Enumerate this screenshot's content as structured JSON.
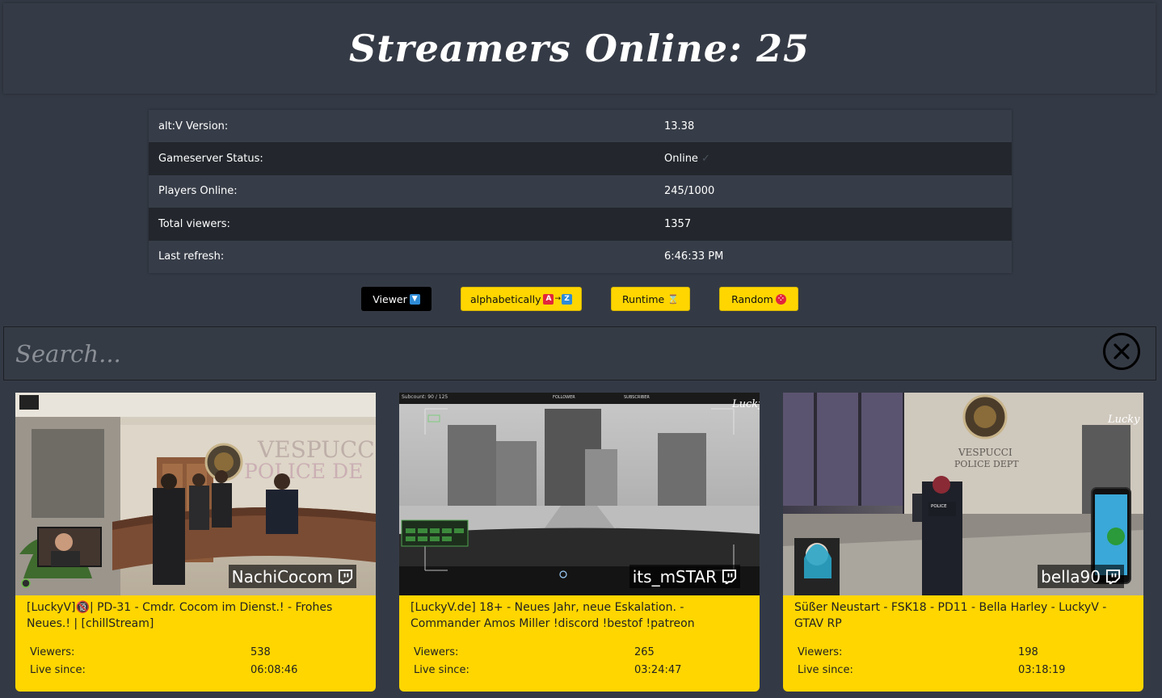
{
  "header": {
    "title": "Streamers Online: 25"
  },
  "info": [
    {
      "label": "alt:V Version:",
      "value": "13.38"
    },
    {
      "label": "Gameserver Status:",
      "value": "Online",
      "check": "✓"
    },
    {
      "label": "Players Online:",
      "value": "245/1000"
    },
    {
      "label": "Total viewers:",
      "value": "1357"
    },
    {
      "label": "Last refresh:",
      "value": "6:46:33 PM"
    }
  ],
  "sort": {
    "viewer": "Viewer",
    "alpha": "alphabetically",
    "runtime": "Runtime",
    "random": "Random",
    "alpha_from": "A",
    "alpha_to": "Z"
  },
  "search": {
    "placeholder": "Search..."
  },
  "labels": {
    "viewers": "Viewers:",
    "live_since": "Live since:"
  },
  "streams": [
    {
      "name": "NachiCocom",
      "title": "[LuckyV]🔞| PD-31 - Cmdr. Cocom im Dienst.! - Frohes Neues.! | [chillStream]",
      "viewers": "538",
      "live_since": "06:08:46",
      "overlay_text": [
        "VESPUCC",
        "POLICE DE"
      ]
    },
    {
      "name": "its_mSTAR",
      "title": "[LuckyV.de] 18+ - Neues Jahr, neue Eskalation. - Commander Amos Miller !discord !bestof !patreon",
      "viewers": "265",
      "live_since": "03:24:47",
      "overlay_text": [
        "Subcount: 90 / 125",
        "FOLLOWER",
        "SUBSCRIBER",
        "Lucky"
      ]
    },
    {
      "name": "bella90",
      "title": "Süßer Neustart - FSK18 - PD11 - Bella Harley - LuckyV - GTAV RP",
      "viewers": "198",
      "live_since": "03:18:19",
      "overlay_text": [
        "VESPUCCI",
        "POLICE DEPT",
        "Lucky",
        "POLICE"
      ]
    }
  ],
  "colors": {
    "background": "#343a45",
    "card_yellow": "#ffd600",
    "row_dark": "#23272d",
    "row_light": "#373d48",
    "active_btn": "#000000"
  }
}
